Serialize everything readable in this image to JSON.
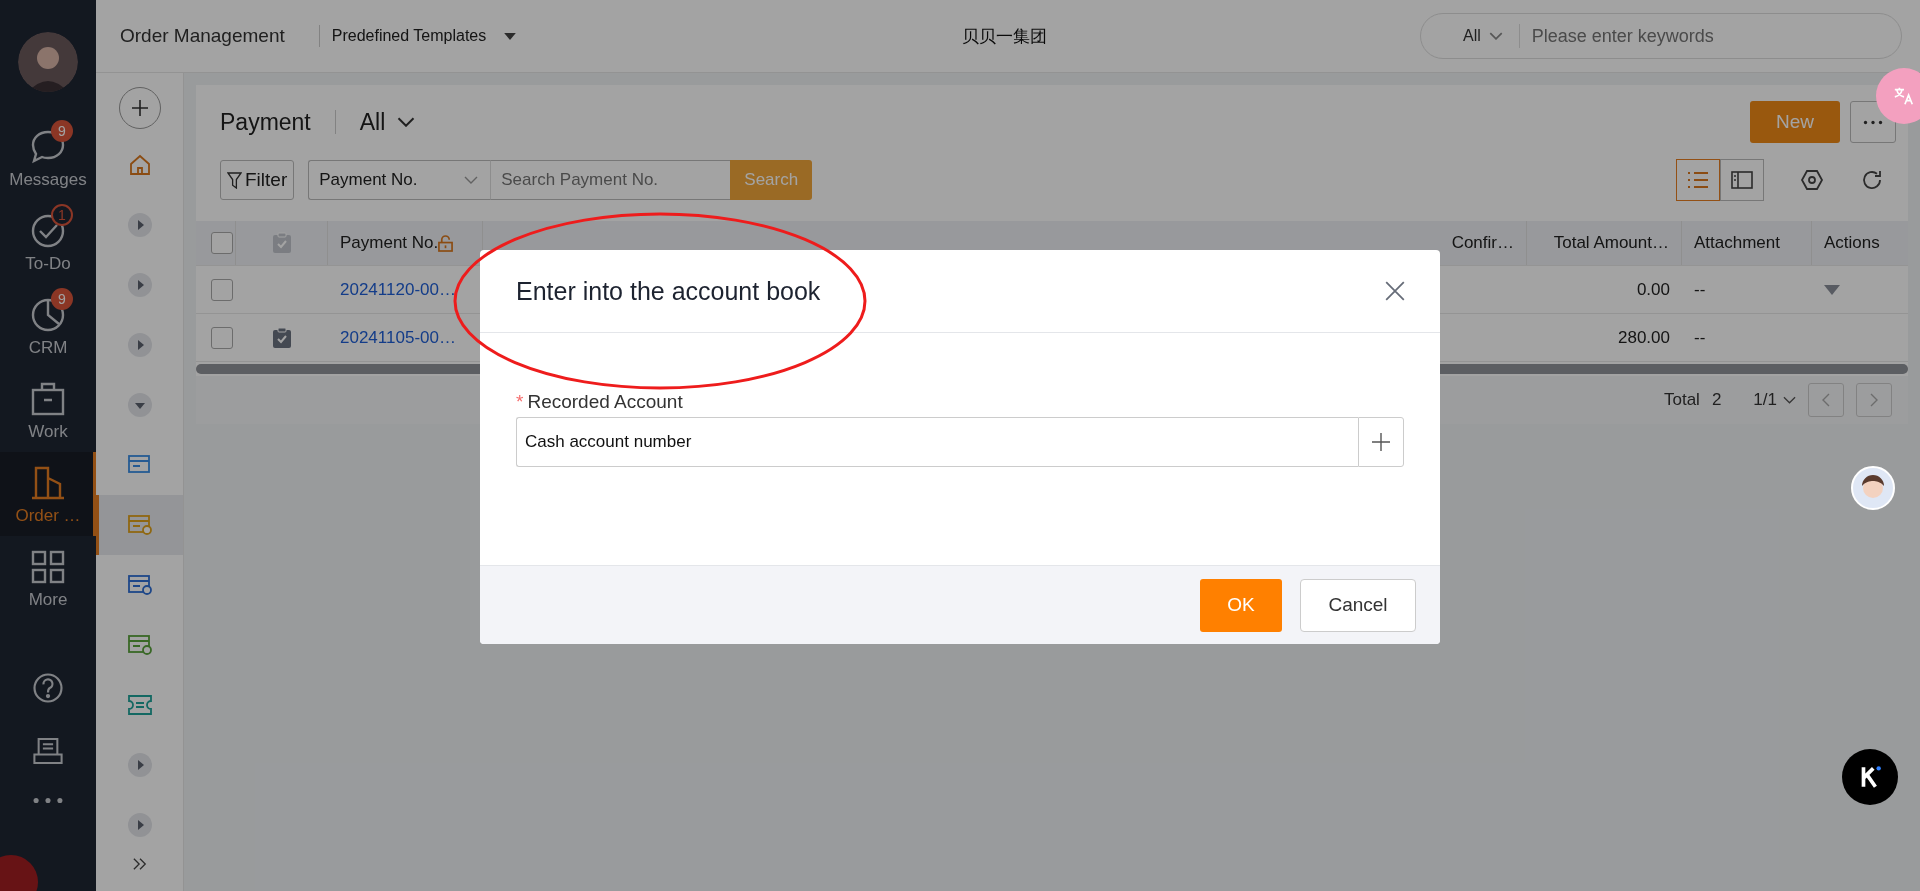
{
  "nav": {
    "items": [
      {
        "label": "Messages",
        "kind": "chat",
        "badge": "9",
        "badge_outlined": false,
        "selected": false
      },
      {
        "label": "To-Do",
        "kind": "check",
        "badge": "1",
        "badge_outlined": true,
        "selected": false
      },
      {
        "label": "CRM",
        "kind": "pie",
        "badge": "9",
        "badge_outlined": false,
        "selected": false
      },
      {
        "label": "Work",
        "kind": "case",
        "selected": false
      },
      {
        "label": "Order …",
        "kind": "building",
        "selected": true
      },
      {
        "label": "More",
        "kind": "grid",
        "selected": false
      }
    ],
    "bottom": [
      {
        "kind": "help"
      },
      {
        "kind": "inbox"
      },
      {
        "kind": "dots"
      }
    ]
  },
  "subnav": {
    "items": [
      {
        "kind": "home",
        "selected": false
      },
      {
        "kind": "collapsed",
        "selected": false
      },
      {
        "kind": "collapsed",
        "selected": false
      },
      {
        "kind": "collapsed",
        "selected": false
      },
      {
        "kind": "expanded",
        "selected": false
      },
      {
        "kind": "receive",
        "selected": false
      },
      {
        "kind": "pay",
        "selected": true
      },
      {
        "kind": "verify",
        "selected": false
      },
      {
        "kind": "transfer",
        "selected": false
      },
      {
        "kind": "ticket",
        "selected": false
      },
      {
        "kind": "collapsed",
        "selected": false
      },
      {
        "kind": "collapsed",
        "selected": false
      }
    ]
  },
  "topbar": {
    "title": "Order Management",
    "template": "Predefined Templates",
    "company": "贝贝一集团",
    "scope": "All",
    "search_placeholder": "Please enter keywords"
  },
  "page": {
    "title": "Payment",
    "view": "All",
    "new_button": "New",
    "filter_button": "Filter",
    "search_field": "Payment No.",
    "search_placeholder": "Search Payment No.",
    "search_button": "Search"
  },
  "table": {
    "all_selected": false,
    "columns": [
      "Payment No.",
      "Confir…",
      "Total Amount…",
      "Attachment",
      "Actions"
    ],
    "rows": [
      {
        "selected": false,
        "confirmed": false,
        "payment_no": "20241120-00…",
        "total": "0.00",
        "attachment": "--",
        "has_actions": true
      },
      {
        "selected": false,
        "confirmed": true,
        "payment_no": "20241105-00…",
        "total": "280.00",
        "attachment": "--",
        "has_actions": false
      }
    ],
    "total_label": "Total",
    "total": "2",
    "page": "1/1"
  },
  "dialog": {
    "title": "Enter into the account book",
    "field_label": "Recorded Account",
    "required_mark": "*",
    "value": "Cash account number",
    "ok": "OK",
    "cancel": "Cancel"
  }
}
